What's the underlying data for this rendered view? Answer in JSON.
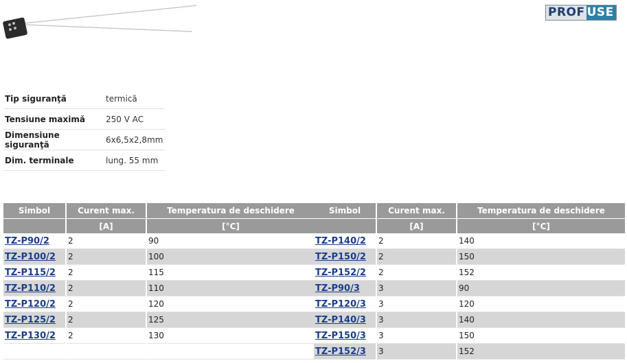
{
  "logo": {
    "part1": "PROF",
    "part2": "USE"
  },
  "specs": [
    {
      "key": "Tip siguranţă",
      "value": "termică"
    },
    {
      "key": "Tensiune maximă",
      "value": "250 V AC"
    },
    {
      "key": "Dimensiune siguranţă",
      "value": "6x6,5x2,8mm"
    },
    {
      "key": "Dim. terminale",
      "value": "lung. 55 mm"
    }
  ],
  "table_headers": {
    "simbol": "Simbol",
    "curent": "Curent max.",
    "temp": "Temperatura de deschidere",
    "curent_unit": "[A]",
    "temp_unit": "[°C]"
  },
  "left_table": [
    {
      "sym": "TZ-P90/2",
      "a": "2",
      "t": "90"
    },
    {
      "sym": "TZ-P100/2",
      "a": "2",
      "t": "100"
    },
    {
      "sym": "TZ-P115/2",
      "a": "2",
      "t": "115"
    },
    {
      "sym": "TZ-P110/2",
      "a": "2",
      "t": "110"
    },
    {
      "sym": "TZ-P120/2",
      "a": "2",
      "t": "120"
    },
    {
      "sym": "TZ-P125/2",
      "a": "2",
      "t": "125"
    },
    {
      "sym": "TZ-P130/2",
      "a": "2",
      "t": "130"
    }
  ],
  "right_table": [
    {
      "sym": "TZ-P140/2",
      "a": "2",
      "t": "140"
    },
    {
      "sym": "TZ-P150/2",
      "a": "2",
      "t": "150"
    },
    {
      "sym": "TZ-P152/2",
      "a": "2",
      "t": "152"
    },
    {
      "sym": "TZ-P90/3",
      "a": "3",
      "t": "90"
    },
    {
      "sym": "TZ-P120/3",
      "a": "3",
      "t": "120"
    },
    {
      "sym": "TZ-P140/3",
      "a": "3",
      "t": "140"
    },
    {
      "sym": "TZ-P150/3",
      "a": "3",
      "t": "150"
    },
    {
      "sym": "TZ-P152/3",
      "a": "3",
      "t": "152"
    }
  ]
}
